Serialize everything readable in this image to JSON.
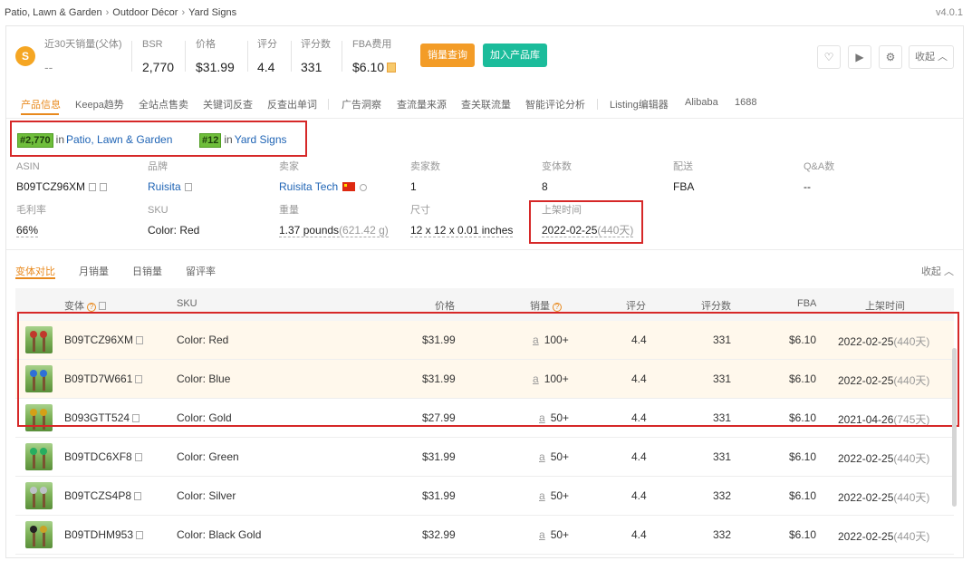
{
  "breadcrumb": [
    "Patio, Lawn & Garden",
    "Outdoor Décor",
    "Yard Signs"
  ],
  "breadcrumb_sep": "›",
  "version": "v4.0.1",
  "summary": {
    "coin": "S",
    "sales30_label": "近30天销量(父体)",
    "sales30_value": "--",
    "bsr_label": "BSR",
    "bsr_value": "2,770",
    "price_label": "价格",
    "price_value": "$31.99",
    "rating_label": "评分",
    "rating_value": "4.4",
    "reviews_label": "评分数",
    "reviews_value": "331",
    "fba_label": "FBA费用",
    "fba_value": "$6.10",
    "btn_sales_query": "销量查询",
    "btn_add_library": "加入产品库",
    "collapse": "收起"
  },
  "tabs": [
    "产品信息",
    "Keepa趋势",
    "全站点售卖",
    "关键词反查",
    "反查出单词",
    "广告洞察",
    "查流量来源",
    "查关联流量",
    "智能评论分析",
    "Listing编辑器",
    "Alibaba",
    "1688"
  ],
  "ranks": [
    {
      "rank": "#2,770",
      "in": "in",
      "category": "Patio, Lawn & Garden"
    },
    {
      "rank": "#12",
      "in": "in",
      "category": "Yard Signs"
    }
  ],
  "info": {
    "asin_label": "ASIN",
    "asin": "B09TCZ96XM",
    "brand_label": "品牌",
    "brand": "Ruisita",
    "seller_label": "卖家",
    "seller": "Ruisita Tech",
    "sellers_count_label": "卖家数",
    "sellers_count": "1",
    "variants_label": "变体数",
    "variants": "8",
    "delivery_label": "配送",
    "delivery": "FBA",
    "qa_label": "Q&A数",
    "qa": "--",
    "margin_label": "毛利率",
    "margin": "66%",
    "sku_label": "SKU",
    "sku": "Color: Red",
    "weight_label": "重量",
    "weight": "1.37 pounds",
    "weight_g": "(621.42 g)",
    "size_label": "尺寸",
    "size": "12 x 12 x 0.01 inches",
    "listed_label": "上架时间",
    "listed": "2022-02-25",
    "listed_days": "(440天)"
  },
  "subtabs": [
    "变体对比",
    "月销量",
    "日销量",
    "留评率"
  ],
  "subtabs_collapse": "收起",
  "table": {
    "headers": {
      "variant": "变体",
      "sku": "SKU",
      "price": "价格",
      "sales": "销量",
      "rating": "评分",
      "reviews": "评分数",
      "fba": "FBA",
      "listed": "上架时间"
    },
    "sales_prefix": "a",
    "rows": [
      {
        "asin": "B09TCZ96XM",
        "sku": "Color: Red",
        "price": "$31.99",
        "sales": "100+",
        "rating": "4.4",
        "reviews": "331",
        "fba": "$6.10",
        "date": "2022-02-25",
        "days": "(440天)"
      },
      {
        "asin": "B09TD7W661",
        "sku": "Color: Blue",
        "price": "$31.99",
        "sales": "100+",
        "rating": "4.4",
        "reviews": "331",
        "fba": "$6.10",
        "date": "2022-02-25",
        "days": "(440天)"
      },
      {
        "asin": "B093GTT524",
        "sku": "Color: Gold",
        "price": "$27.99",
        "sales": "50+",
        "rating": "4.4",
        "reviews": "331",
        "fba": "$6.10",
        "date": "2021-04-26",
        "days": "(745天)"
      },
      {
        "asin": "B09TDC6XF8",
        "sku": "Color: Green",
        "price": "$31.99",
        "sales": "50+",
        "rating": "4.4",
        "reviews": "331",
        "fba": "$6.10",
        "date": "2022-02-25",
        "days": "(440天)"
      },
      {
        "asin": "B09TCZS4P8",
        "sku": "Color: Silver",
        "price": "$31.99",
        "sales": "50+",
        "rating": "4.4",
        "reviews": "332",
        "fba": "$6.10",
        "date": "2022-02-25",
        "days": "(440天)"
      },
      {
        "asin": "B09TDHM953",
        "sku": "Color: Black Gold",
        "price": "$32.99",
        "sales": "50+",
        "rating": "4.4",
        "reviews": "332",
        "fba": "$6.10",
        "date": "2022-02-25",
        "days": "(440天)"
      }
    ]
  },
  "colors": {
    "accent": "#e8891d",
    "highlight_border": "#d62828",
    "teal": "#1bbc9b",
    "orange": "#f39c27",
    "rank_pill": "#6fbe3b"
  }
}
